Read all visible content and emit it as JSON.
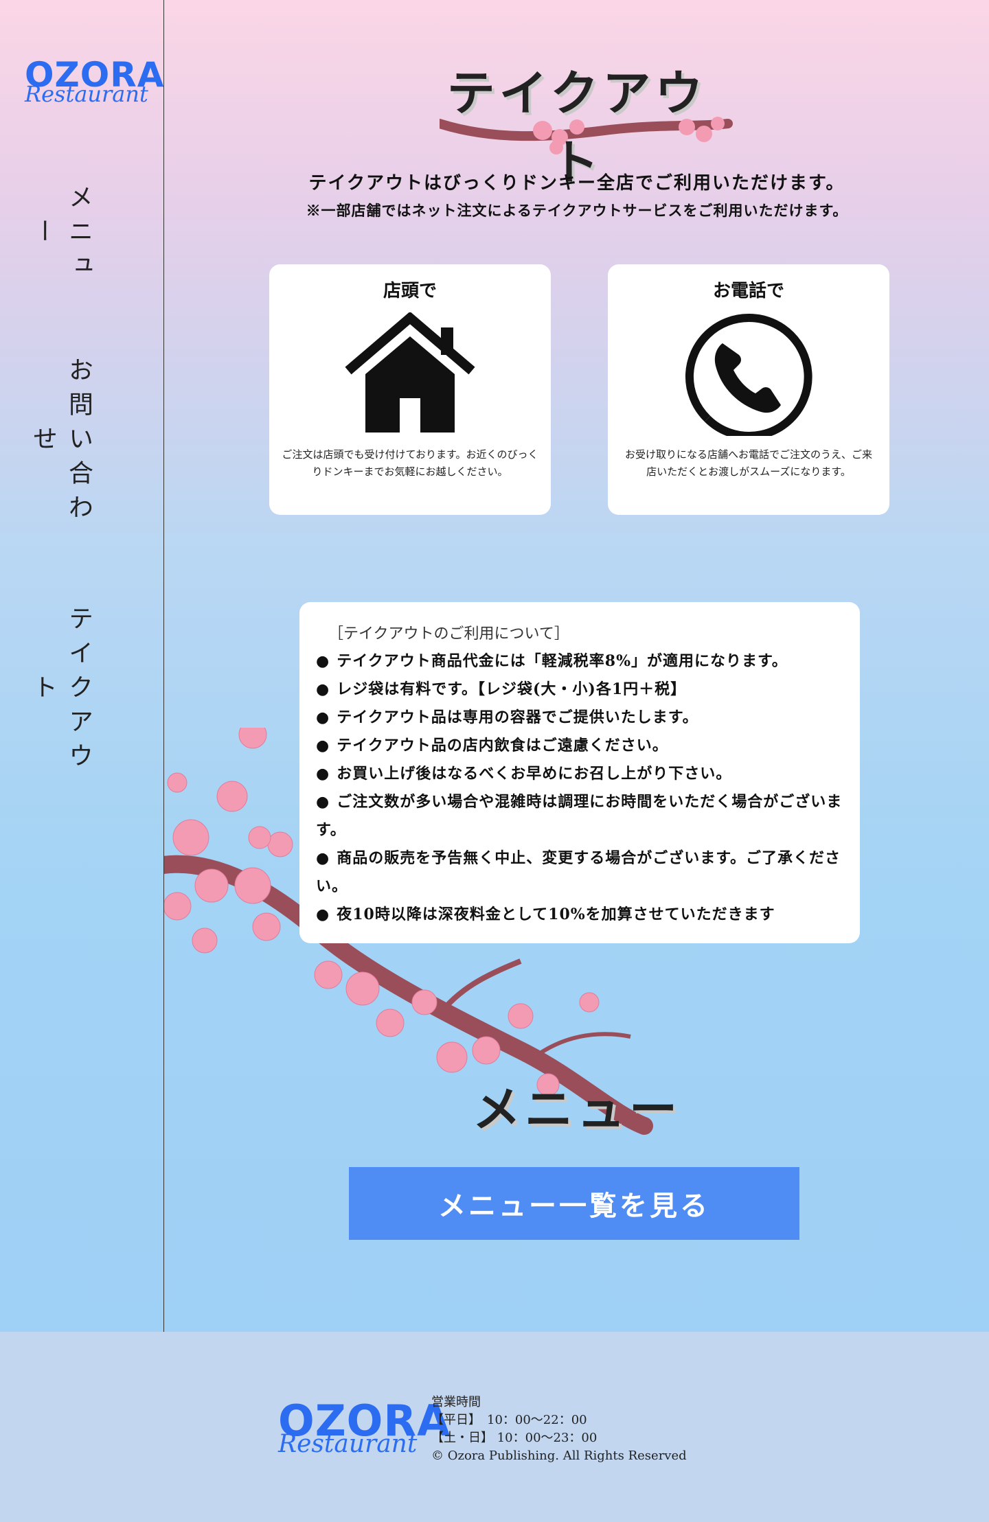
{
  "colors": {
    "accent": "#4f8df4",
    "logo": "#2b6cf0",
    "blossom": "#f39bb3",
    "branch": "#9a4e5a"
  },
  "brand": {
    "name": "OZORA",
    "sub": "Restaurant"
  },
  "nav": [
    {
      "label": "メニュー"
    },
    {
      "label": "お問い合わせ"
    },
    {
      "label": "テイクアウト"
    }
  ],
  "page": {
    "title": "テイクアウト",
    "intro1": "テイクアウトはびっくりドンキー全店でご利用いただけます。",
    "intro2": "※一部店舗ではネット注文によるテイクアウトサービスをご利用いただけます。"
  },
  "cards": [
    {
      "title": "店頭で",
      "icon": "house-icon",
      "text": "ご注文は店頭でも受け付けております。お近くのびっくりドンキーまでお気軽にお越しください。"
    },
    {
      "title": "お電話で",
      "icon": "phone-icon",
      "text": "お受け取りになる店舗へお電話でご注文のうえ、ご来店いただくとお渡しがスムーズになります。"
    }
  ],
  "info": {
    "heading": "［テイクアウトのご利用について］",
    "bullet": "●",
    "items": [
      "テイクアウト商品代金には「軽減税率8%」が適用になります。",
      "レジ袋は有料です。【レジ袋(大・小)各1円＋税】",
      "テイクアウト品は専用の容器でご提供いたします。",
      "テイクアウト品の店内飲食はご遠慮ください。",
      "お買い上げ後はなるべくお早めにお召し上がり下さい。",
      "ご注文数が多い場合や混雑時は調理にお時間をいただく場合がございます。",
      "商品の販売を予告無く中止、変更する場合がございます。ご了承ください。",
      "夜10時以降は深夜料金として10%を加算させていただきます"
    ]
  },
  "menu": {
    "title": "メニュー",
    "button": "メニュー一覧を見る"
  },
  "footer": {
    "hours_label": "営業時間",
    "weekday": "【平日】　10：00～22：00",
    "weekend": "【土・日】 10：00～23：00",
    "copyright": "© Ozora Publishing. All Rights Reserved"
  }
}
